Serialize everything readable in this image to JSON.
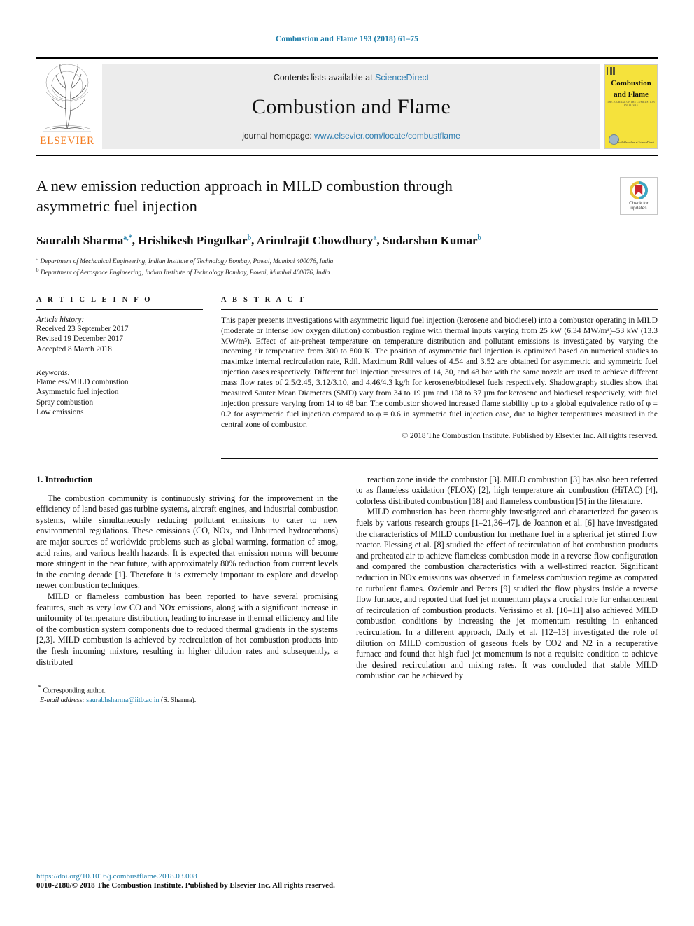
{
  "running_head": "Combustion and Flame 193 (2018) 61–75",
  "masthead": {
    "contents_prefix": "Contents lists available at ",
    "contents_link": "ScienceDirect",
    "journal_title": "Combustion and Flame",
    "homepage_prefix": "journal homepage: ",
    "homepage_url": "www.elsevier.com/locate/combustflame",
    "publisher": "ELSEVIER",
    "cover": {
      "line1": "Combustion",
      "line2": "and Flame",
      "subtitle": "THE JOURNAL OF THE COMBUSTION INSTITUTE",
      "corner_text": "Available online at\nScienceDirect"
    }
  },
  "article": {
    "title": "A new emission reduction approach in MILD combustion through asymmetric fuel injection",
    "crossmark_label": "Check for updates",
    "authors": [
      {
        "name": "Saurabh Sharma",
        "marks": "a,*"
      },
      {
        "name": "Hrishikesh Pingulkar",
        "marks": "b"
      },
      {
        "name": "Arindrajit Chowdhury",
        "marks": "a"
      },
      {
        "name": "Sudarshan Kumar",
        "marks": "b"
      }
    ],
    "affiliations": [
      {
        "mark": "a",
        "text": "Department of Mechanical Engineering, Indian Institute of Technology Bombay, Powai, Mumbai 400076, India"
      },
      {
        "mark": "b",
        "text": "Department of Aerospace Engineering, Indian Institute of Technology Bombay, Powai, Mumbai 400076, India"
      }
    ]
  },
  "article_info": {
    "heading": "A R T I C L E   I N F O",
    "history_label": "Article history:",
    "history": [
      "Received 23 September 2017",
      "Revised 19 December 2017",
      "Accepted 8 March 2018"
    ],
    "keywords_label": "Keywords:",
    "keywords": [
      "Flameless/MILD combustion",
      "Asymmetric fuel injection",
      "Spray combustion",
      "Low emissions"
    ]
  },
  "abstract": {
    "heading": "A B S T R A C T",
    "text": "This paper presents investigations with asymmetric liquid fuel injection (kerosene and biodiesel) into a combustor operating in MILD (moderate or intense low oxygen dilution) combustion regime with thermal inputs varying from 25 kW (6.34 MW/m³)–53 kW (13.3 MW/m³). Effect of air-preheat temperature on temperature distribution and pollutant emissions is investigated by varying the incoming air temperature from 300 to 800 K. The position of asymmetric fuel injection is optimized based on numerical studies to maximize internal recirculation rate, Rdil. Maximum Rdil values of 4.54 and 3.52 are obtained for asymmetric and symmetric fuel injection cases respectively. Different fuel injection pressures of 14, 30, and 48 bar with the same nozzle are used to achieve different mass flow rates of 2.5/2.45, 3.12/3.10, and 4.46/4.3 kg/h for kerosene/biodiesel fuels respectively. Shadowgraphy studies show that measured Sauter Mean Diameters (SMD) vary from 34 to 19 µm and 108 to 37 µm for kerosene and biodiesel respectively, with fuel injection pressure varying from 14 to 48 bar. The combustor showed increased flame stability up to a global equivalence ratio of φ = 0.2 for asymmetric fuel injection compared to φ = 0.6 in symmetric fuel injection case, due to higher temperatures measured in the central zone of combustor.",
    "copyright": "© 2018 The Combustion Institute. Published by Elsevier Inc. All rights reserved."
  },
  "body": {
    "section_title": "1. Introduction",
    "left_paragraphs": [
      "The combustion community is continuously striving for the improvement in the efficiency of land based gas turbine systems, aircraft engines, and industrial combustion systems, while simultaneously reducing pollutant emissions to cater to new environmental regulations. These emissions (CO, NOx, and Unburned hydrocarbons) are major sources of worldwide problems such as global warming, formation of smog, acid rains, and various health hazards. It is expected that emission norms will become more stringent in the near future, with approximately 80% reduction from current levels in the coming decade [1]. Therefore it is extremely important to explore and develop newer combustion techniques.",
      "MILD or flameless combustion has been reported to have several promising features, such as very low CO and NOx emissions, along with a significant increase in uniformity of temperature distribution, leading to increase in thermal efficiency and life of the combustion system components due to reduced thermal gradients in the systems [2,3]. MILD combustion is achieved by recirculation of hot combustion products into the fresh incoming mixture, resulting in higher dilution rates and subsequently, a distributed"
    ],
    "right_paragraphs": [
      "reaction zone inside the combustor [3]. MILD combustion [3] has also been referred to as flameless oxidation (FLOX) [2], high temperature air combustion (HiTAC) [4], colorless distributed combustion [18] and flameless combustion [5] in the literature.",
      "MILD combustion has been thoroughly investigated and characterized for gaseous fuels by various research groups [1–21,36–47]. de Joannon et al. [6] have investigated the characteristics of MILD combustion for methane fuel in a spherical jet stirred flow reactor. Plessing et al. [8] studied the effect of recirculation of hot combustion products and preheated air to achieve flameless combustion mode in a reverse flow configuration and compared the combustion characteristics with a well-stirred reactor. Significant reduction in NOx emissions was observed in flameless combustion regime as compared to turbulent flames. Ozdemir and Peters [9] studied the flow physics inside a reverse flow furnace, and reported that fuel jet momentum plays a crucial role for enhancement of recirculation of combustion products. Verissimo et al. [10–11] also achieved MILD combustion conditions by increasing the jet momentum resulting in enhanced recirculation. In a different approach, Dally et al. [12–13] investigated the role of dilution on MILD combustion of gaseous fuels by CO2 and N2 in a recuperative furnace and found that high fuel jet momentum is not a requisite condition to achieve the desired recirculation and mixing rates. It was concluded that stable MILD combustion can be achieved by"
    ]
  },
  "footnote": {
    "corresponding": "Corresponding author.",
    "email_label": "E-mail address:",
    "email": "saurabhsharma@iitb.ac.in",
    "email_suffix": "(S. Sharma)."
  },
  "page_footer": {
    "doi": "https://doi.org/10.1016/j.combustflame.2018.03.008",
    "issn_line": "0010-2180/© 2018 The Combustion Institute. Published by Elsevier Inc. All rights reserved."
  },
  "colors": {
    "link": "#1b7ca8",
    "sciencedirect": "#2c7cb0",
    "elsevier_orange": "#f47c20",
    "cover_yellow": "#f5e23c",
    "masthead_grey": "#ececec"
  }
}
